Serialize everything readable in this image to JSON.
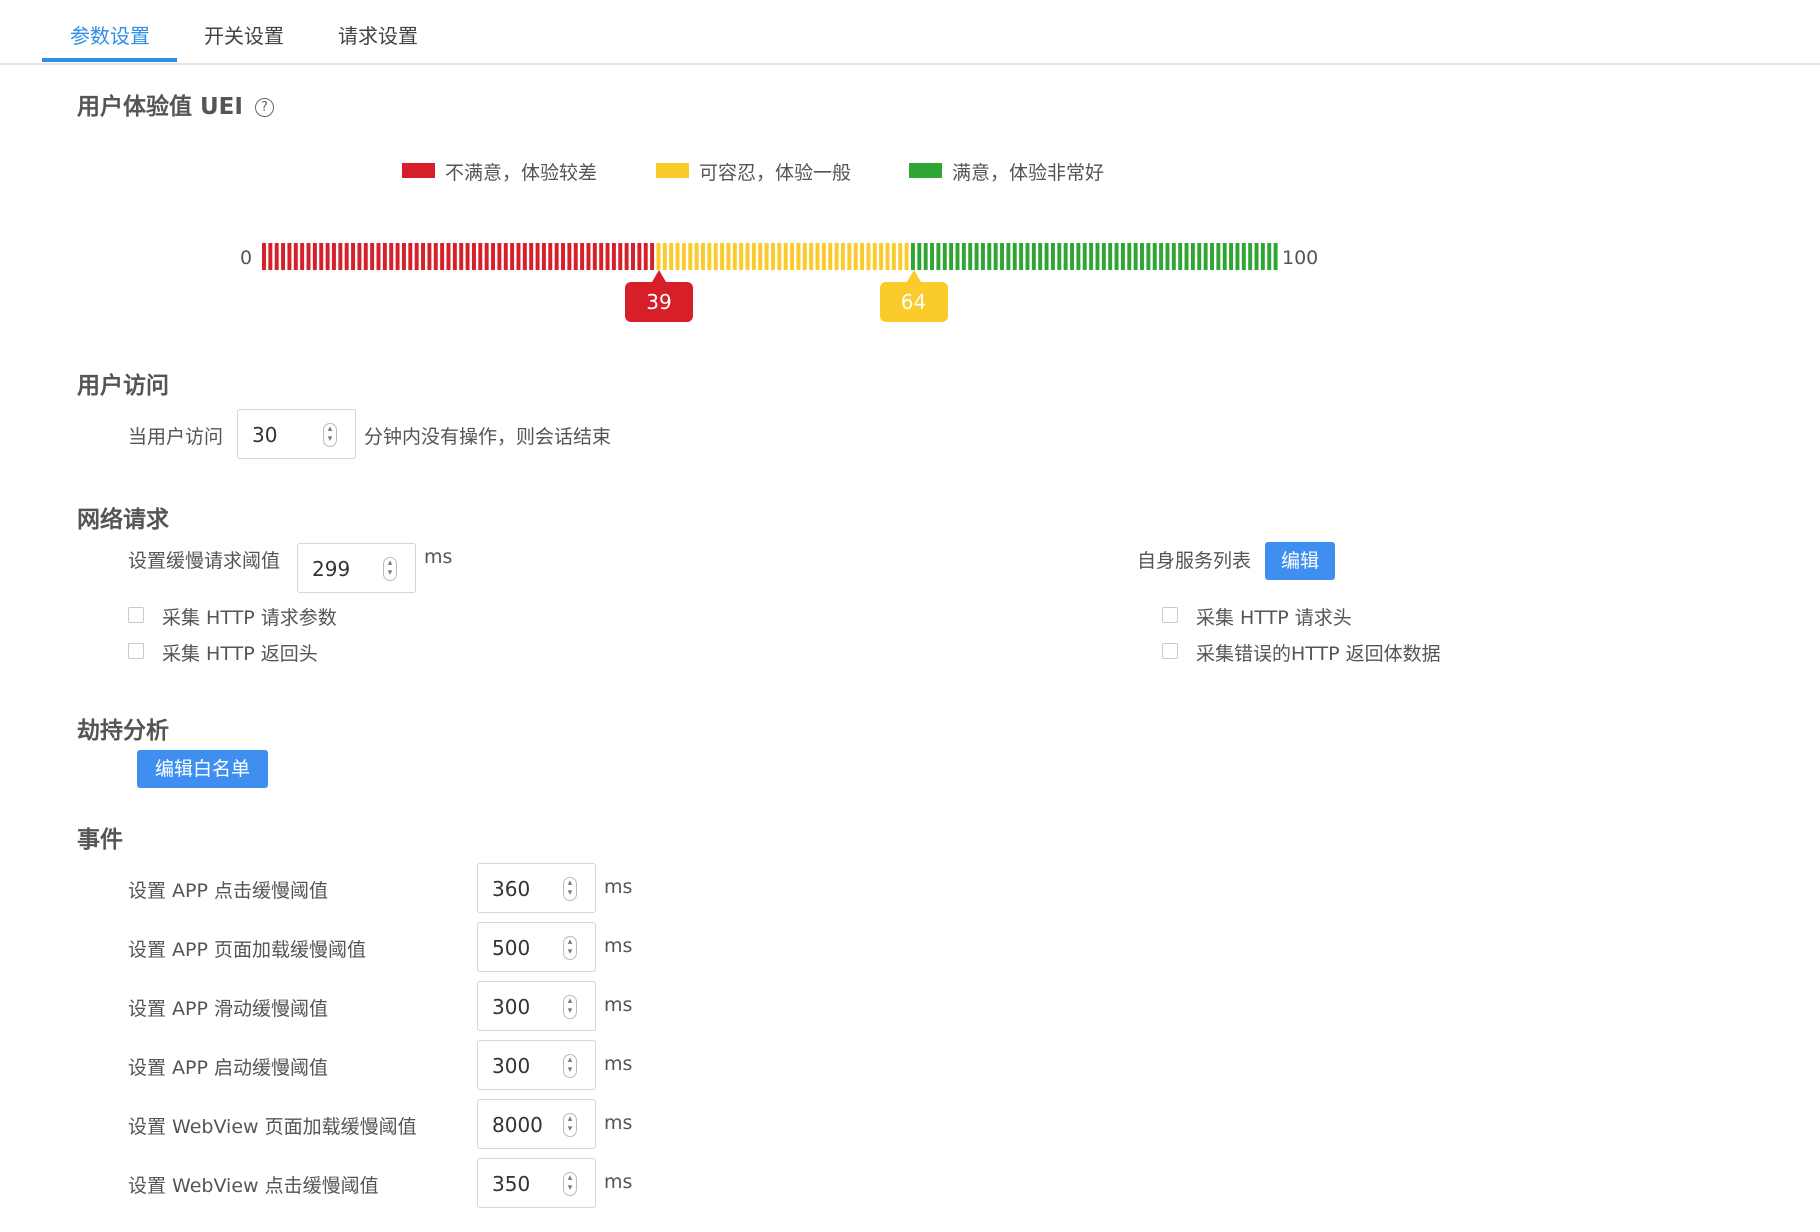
{
  "tabs": [
    {
      "label": "参数设置",
      "active": true
    },
    {
      "label": "开关设置",
      "active": false
    },
    {
      "label": "请求设置",
      "active": false
    }
  ],
  "uei": {
    "title": "用户体验值 UEI",
    "help_icon": "question-circle-icon",
    "legend": [
      {
        "label": "不满意，体验较差",
        "color": "#d71f2a"
      },
      {
        "label": "可容忍，体验一般",
        "color": "#fbcb2c"
      },
      {
        "label": "满意，体验非常好",
        "color": "#2fa534"
      }
    ],
    "scale_min": "0",
    "scale_max": "100",
    "min": 0,
    "max": 100,
    "threshold_low": 39,
    "threshold_high": 64,
    "threshold_low_label": "39",
    "threshold_high_label": "64"
  },
  "user_access": {
    "title": "用户访问",
    "prefix": "当用户访问",
    "value": "30",
    "suffix": "分钟内没有操作，则会话结束"
  },
  "network": {
    "title": "网络请求",
    "slow_label": "设置缓慢请求阈值",
    "slow_value": "299",
    "slow_unit": "ms",
    "service_list_label": "自身服务列表",
    "edit_button": "编辑",
    "checkboxes": [
      {
        "label": "采集 HTTP 请求参数",
        "checked": false
      },
      {
        "label": "采集 HTTP 返回头",
        "checked": false
      },
      {
        "label": "采集 HTTP 请求头",
        "checked": false
      },
      {
        "label": "采集错误的HTTP 返回体数据",
        "checked": false
      }
    ]
  },
  "hijack": {
    "title": "劫持分析",
    "whitelist_button": "编辑白名单"
  },
  "events": {
    "title": "事件",
    "rows": [
      {
        "label": "设置 APP 点击缓慢阈值",
        "value": "360",
        "unit": "ms"
      },
      {
        "label": "设置 APP 页面加载缓慢阈值",
        "value": "500",
        "unit": "ms"
      },
      {
        "label": "设置 APP 滑动缓慢阈值",
        "value": "300",
        "unit": "ms"
      },
      {
        "label": "设置 APP 启动缓慢阈值",
        "value": "300",
        "unit": "ms"
      },
      {
        "label": "设置 WebView 页面加载缓慢阈值",
        "value": "8000",
        "unit": "ms"
      },
      {
        "label": "设置 WebView 点击缓慢阈值",
        "value": "350",
        "unit": "ms"
      }
    ]
  }
}
